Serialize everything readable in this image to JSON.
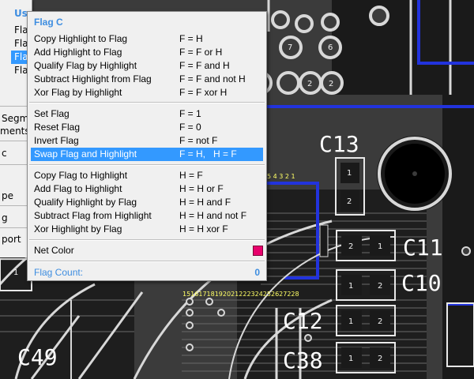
{
  "parent_menu": {
    "title": "Us",
    "items": [
      "Fla",
      "Fla",
      "Fla",
      "Fla"
    ],
    "lower_items": [
      "Segm",
      "ments",
      "c",
      "pe",
      "g",
      "port"
    ]
  },
  "flag_menu": {
    "title": "Flag C",
    "groups": [
      [
        {
          "label": "Copy Highlight to Flag",
          "formula": "F = H"
        },
        {
          "label": "Add Highlight to Flag",
          "formula": "F = F or H"
        },
        {
          "label": "Qualify Flag by Highlight",
          "formula": "F = F and H"
        },
        {
          "label": "Subtract Highlight from Flag",
          "formula": "F = F and not H"
        },
        {
          "label": "Xor Flag by Highlight",
          "formula": "F = F xor H"
        }
      ],
      [
        {
          "label": "Set Flag",
          "formula": "F = 1"
        },
        {
          "label": "Reset Flag",
          "formula": "F = 0"
        },
        {
          "label": "Invert Flag",
          "formula": "F = not F"
        },
        {
          "label": "Swap Flag and Highlight",
          "formula": "F = H,   H = F"
        }
      ],
      [
        {
          "label": "Copy Flag to Highlight",
          "formula": "H = F"
        },
        {
          "label": "Add Flag to Highlight",
          "formula": "H = H or F"
        },
        {
          "label": "Qualify Highlight by Flag",
          "formula": "H = H and F"
        },
        {
          "label": "Subtract Flag from Highlight",
          "formula": "H = H and not F"
        },
        {
          "label": "Xor Highlight by Flag",
          "formula": "H = H xor F"
        }
      ]
    ],
    "net_color": {
      "label": "Net Color",
      "color": "#e8006c"
    },
    "flag_count": {
      "label": "Flag Count:",
      "value": "0"
    }
  },
  "board": {
    "designators": {
      "c13": "C13",
      "c11": "C11",
      "c10": "C10",
      "c12": "C12",
      "c38": "C38",
      "c49": "C49"
    },
    "pad_labels": {
      "p7": "7",
      "p6": "6",
      "p2a": "2",
      "p2b": "2",
      "p1": "1",
      "c13_1": "1",
      "c13_2": "2",
      "c11_1": "1",
      "c11_2": "2",
      "c10_1": "1",
      "c10_2": "2",
      "c12_1": "1",
      "c12_2": "2",
      "c38_1": "1",
      "c38_2": "2",
      "left_1": "1"
    },
    "pin_strip_top": "5 4 3 2 1",
    "pin_strip_bottom": "15161718192021222324252627228"
  },
  "colors": {
    "board_bg": "#3b3b3b",
    "highlight": "#3399ff",
    "menu_title": "#3d8de0",
    "trace_blue": "#2233dd"
  }
}
